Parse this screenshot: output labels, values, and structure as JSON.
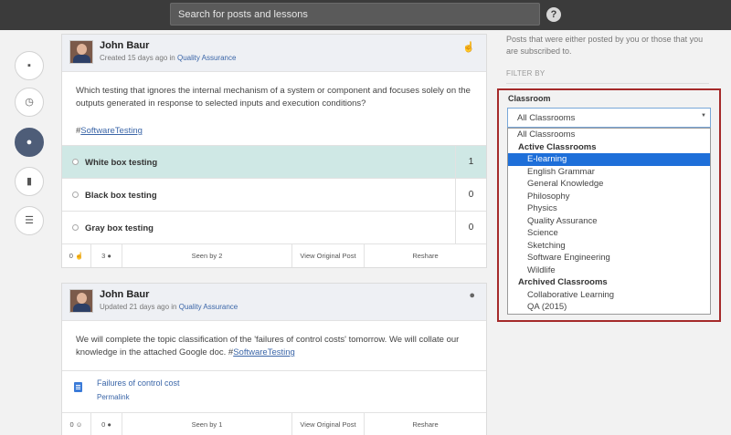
{
  "search": {
    "placeholder": "Search for posts and lessons"
  },
  "help_icon": "?",
  "nav": [
    {
      "icon": "chat-icon"
    },
    {
      "icon": "clock-icon"
    },
    {
      "icon": "speech-bubble-icon"
    },
    {
      "icon": "book-icon"
    },
    {
      "icon": "list-icon"
    }
  ],
  "post1": {
    "author": "John Baur",
    "meta_prefix": "Created 15 days ago in",
    "classroom": "Quality Assurance",
    "question": "Which testing that ignores the internal mechanism of a system or component and focuses solely on the outputs generated in response to selected inputs and execution conditions?",
    "tag": "SoftwareTesting",
    "options": [
      {
        "label": "White box testing",
        "count": "1",
        "selected": true
      },
      {
        "label": "Black box testing",
        "count": "0",
        "selected": false
      },
      {
        "label": "Gray box testing",
        "count": "0",
        "selected": false
      }
    ],
    "footer": {
      "likes": "0",
      "comments": "3",
      "seen": "Seen by 2",
      "view": "View Original Post",
      "reshare": "Reshare"
    }
  },
  "post2": {
    "author": "John Baur",
    "meta_prefix": "Updated 21 days ago in",
    "classroom": "Quality Assurance",
    "body": "We will complete the topic classification of the 'failures of control costs' tomorrow. We will collate our knowledge in the attached Google doc.",
    "tag": "SoftwareTesting",
    "attachment": {
      "title": "Failures of control cost",
      "permalink": "Permalink"
    },
    "footer": {
      "likes": "0",
      "comments": "0",
      "seen": "Seen by 1",
      "view": "View Original Post",
      "reshare": "Reshare"
    }
  },
  "sidebar": {
    "description": "Posts that were either posted by you or those that you are subscribed to.",
    "filter_by": "FILTER BY",
    "classroom_label": "Classroom",
    "selected": "All Classrooms",
    "dropdown": [
      {
        "label": "All Classrooms",
        "type": "item"
      },
      {
        "label": "Active Classrooms",
        "type": "group"
      },
      {
        "label": "E-learning",
        "type": "child",
        "highlight": true
      },
      {
        "label": "English Grammar",
        "type": "child"
      },
      {
        "label": "General Knowledge",
        "type": "child"
      },
      {
        "label": "Philosophy",
        "type": "child"
      },
      {
        "label": "Physics",
        "type": "child"
      },
      {
        "label": "Quality Assurance",
        "type": "child"
      },
      {
        "label": "Science",
        "type": "child"
      },
      {
        "label": "Sketching",
        "type": "child"
      },
      {
        "label": "Software Engineering",
        "type": "child"
      },
      {
        "label": "Wildlife",
        "type": "child"
      },
      {
        "label": "Archived Classrooms",
        "type": "group"
      },
      {
        "label": "Collaborative Learning",
        "type": "child"
      },
      {
        "label": "QA (2015)",
        "type": "child"
      }
    ]
  },
  "colors": {
    "topbar": "#3b3b3b",
    "accent": "#3b66a8",
    "highlight": "#1e6fd9",
    "selected_option": "#cfe8e5",
    "annotation_box": "#a52a2a"
  }
}
